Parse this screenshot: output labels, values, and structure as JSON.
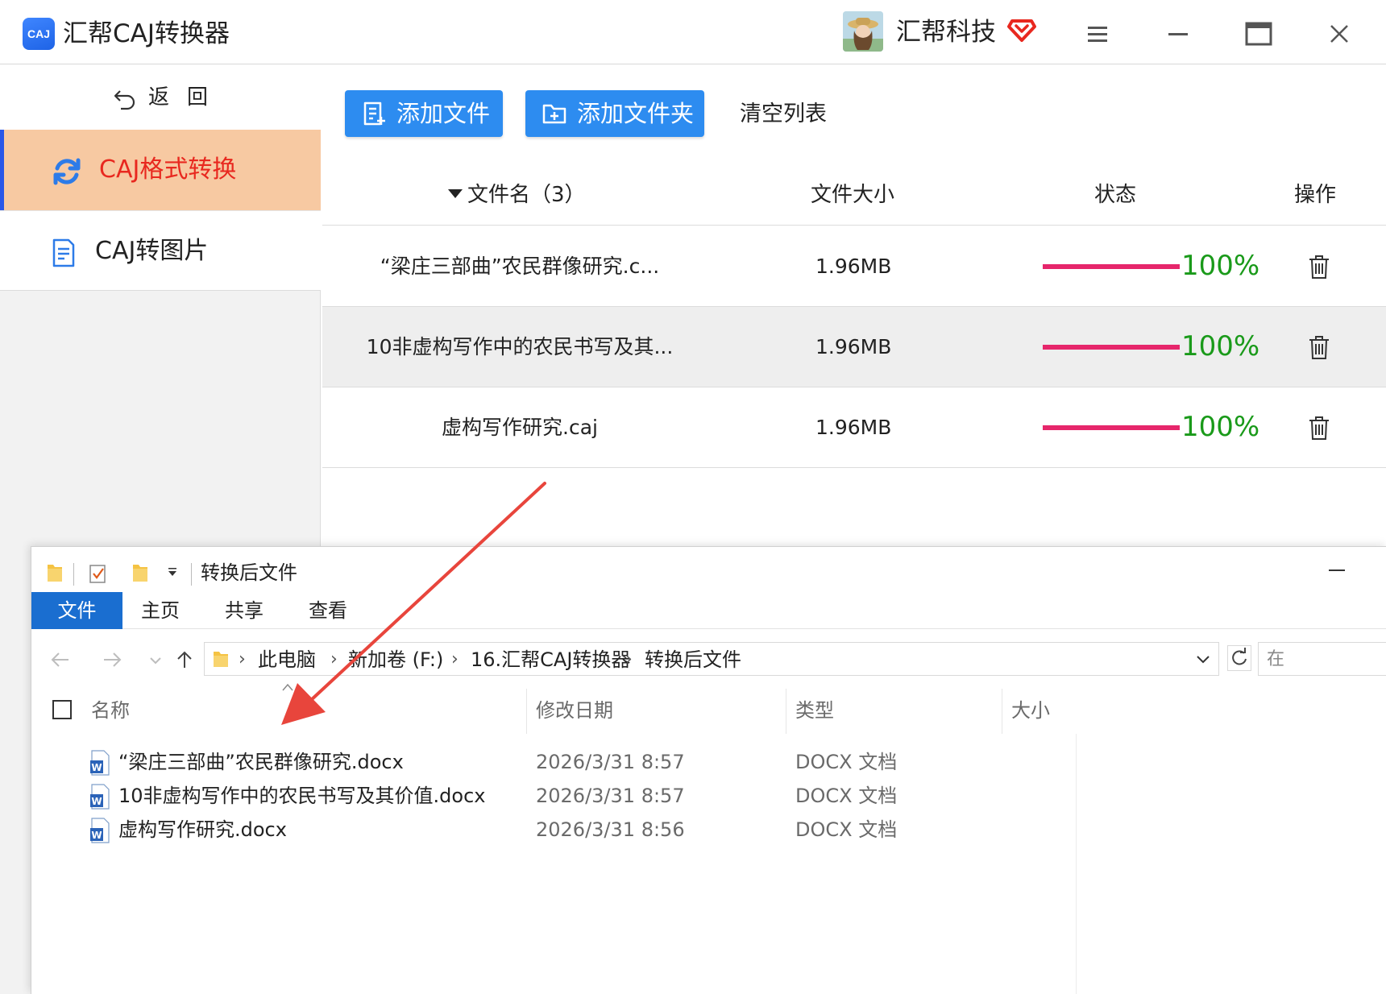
{
  "app": {
    "logo_text": "CAJ",
    "title": "汇帮CAJ转换器",
    "brand": "汇帮科技"
  },
  "sidebar": {
    "back_label": "返回",
    "items": [
      {
        "label": "CAJ格式转换",
        "active": true
      },
      {
        "label": "CAJ转图片",
        "active": false
      }
    ]
  },
  "toolbar": {
    "add_file": "添加文件",
    "add_folder": "添加文件夹",
    "clear_list": "清空列表"
  },
  "table": {
    "headers": {
      "name": "文件名（3）",
      "size": "文件大小",
      "status": "状态",
      "op": "操作"
    },
    "rows": [
      {
        "name": "“梁庄三部曲”农民群像研究.c...",
        "size": "1.96MB",
        "progress": 1.0,
        "percent": "100%"
      },
      {
        "name": "10非虚构写作中的农民书写及其...",
        "size": "1.96MB",
        "progress": 1.0,
        "percent": "100%"
      },
      {
        "name": "虚构写作研究.caj",
        "size": "1.96MB",
        "progress": 1.0,
        "percent": "100%"
      }
    ]
  },
  "explorer": {
    "title": "转换后文件",
    "tabs": [
      "文件",
      "主页",
      "共享",
      "查看"
    ],
    "breadcrumb": [
      "此电脑",
      "新加卷 (F:)",
      "16.汇帮CAJ转换器",
      "转换后文件"
    ],
    "search_placeholder": "在",
    "columns": [
      "名称",
      "修改日期",
      "类型",
      "大小"
    ],
    "files": [
      {
        "name": "“梁庄三部曲”农民群像研究.docx",
        "date": "2026/3/31 8:57",
        "type": "DOCX 文档"
      },
      {
        "name": "10非虚构写作中的农民书写及其价值.docx",
        "date": "2026/3/31 8:57",
        "type": "DOCX 文档"
      },
      {
        "name": "虚构写作研究.docx",
        "date": "2026/3/31 8:56",
        "type": "DOCX 文档"
      }
    ]
  },
  "colors": {
    "primary": "#2d8cf0",
    "active_bg": "#f7c9a2",
    "active_text": "#e8281f",
    "progress": "#e6266b",
    "percent": "#1a9a1a",
    "arrow": "#e8453c",
    "ribbon_file": "#1a6ed0"
  },
  "icons": [
    "menu-icon",
    "minimize-icon",
    "maximize-icon",
    "close-icon",
    "back-arrow-icon",
    "refresh-convert-icon",
    "document-icon",
    "trash-icon",
    "word-doc-icon",
    "folder-icon",
    "vip-diamond-icon"
  ]
}
